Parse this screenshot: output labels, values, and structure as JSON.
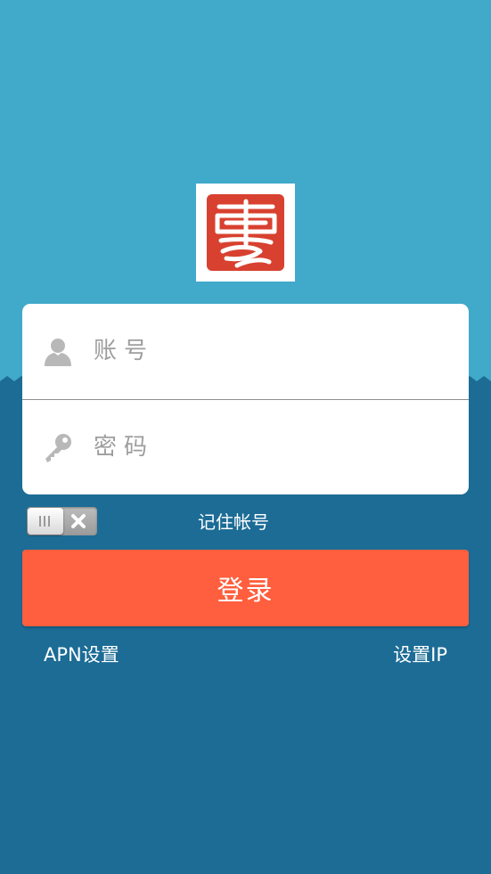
{
  "login": {
    "username_placeholder": "账号",
    "password_placeholder": "密码",
    "remember_label": "记住帐号",
    "remember_checked": false,
    "submit_label": "登录"
  },
  "links": {
    "apn_settings": "APN设置",
    "set_ip": "设置IP"
  },
  "icons": {
    "logo": "red-seal-logo",
    "username": "user-icon",
    "password": "key-icon",
    "toggle_off": "close-icon"
  },
  "colors": {
    "sky": "#41a9c9",
    "sea": "#1c6c96",
    "logo_red": "#d8412f",
    "button": "#ff5f3e"
  }
}
